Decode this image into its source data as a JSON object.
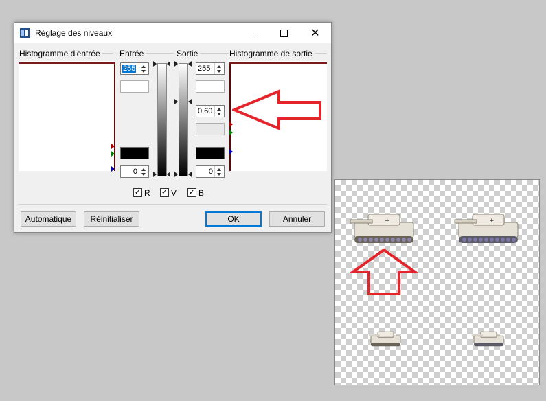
{
  "window": {
    "title": "Réglage des niveaux",
    "icon": "levels-app-icon"
  },
  "sections": {
    "input_histogram": "Histogramme d'entrée",
    "input": "Entrée",
    "output": "Sortie",
    "output_histogram": "Histogramme de sortie"
  },
  "input_controls": {
    "high_value": "255",
    "low_value": "0"
  },
  "output_controls": {
    "high_value": "255",
    "gamma_value": "0,60",
    "low_value": "0"
  },
  "channels": [
    {
      "label": "R",
      "checked": true
    },
    {
      "label": "V",
      "checked": true
    },
    {
      "label": "B",
      "checked": true
    }
  ],
  "buttons": {
    "auto": "Automatique",
    "reset": "Réinitialiser",
    "ok": "OK",
    "cancel": "Annuler"
  },
  "colors": {
    "annotation_arrow": "#e3242b",
    "selection": "#0078d7"
  }
}
